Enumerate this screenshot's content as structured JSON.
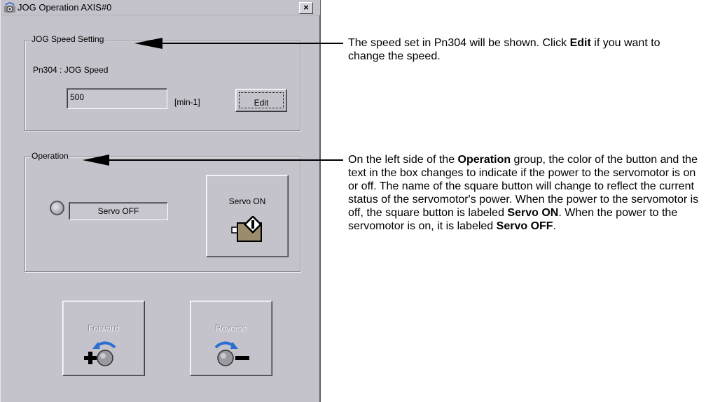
{
  "window": {
    "title": "JOG Operation AXIS#0",
    "close_label": "×",
    "title_icon": "jog-app-icon"
  },
  "speed_group": {
    "legend": "JOG Speed Setting",
    "param_label": "Pn304 : JOG Speed",
    "speed_value": "500",
    "unit": "[min-1]",
    "edit_label": "Edit"
  },
  "operation_group": {
    "legend": "Operation",
    "status_text": "Servo OFF",
    "servo_button_label": "Servo ON",
    "indicator_color": "#b4b3bb"
  },
  "buttons": {
    "forward_label": "Forward",
    "reverse_label": "Reverse"
  },
  "annotations": {
    "speed": {
      "pre": "The speed set in Pn304 will be shown. Click ",
      "bold": "Edit",
      "post": " if you want to change the speed."
    },
    "operation": {
      "p1": "On the left side of the ",
      "b1": "Operation",
      "p2": " group, the color of the button and the text in the box changes to indicate if the power to the servomotor is on or off. The name of the square button will change to reflect the current status of the servomotor's power. When the power to the servomotor is off, the square button is labeled ",
      "b2": "Servo ON",
      "p3": ". When the power to the servomotor is on, it is labeled ",
      "b3": "Servo OFF",
      "p4": "."
    }
  },
  "colors": {
    "window_bg": "#c4c3cb",
    "arrow_blue": "#2a6fd0"
  }
}
